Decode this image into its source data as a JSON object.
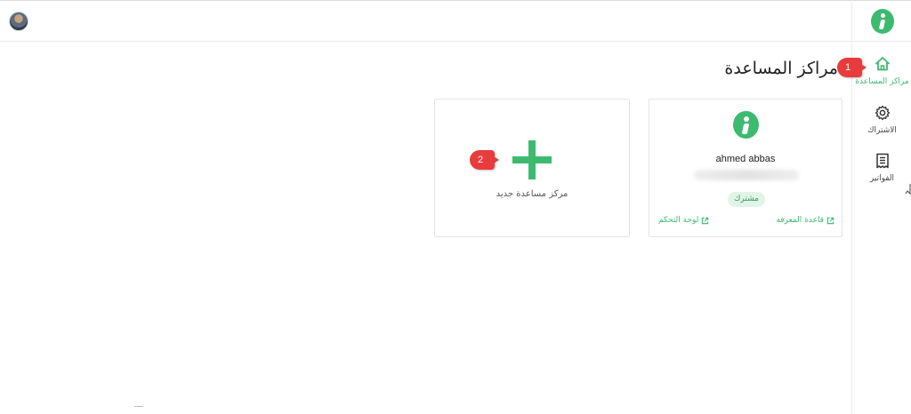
{
  "sidebar": {
    "logo_icon": "info-logo-icon",
    "items": [
      {
        "key": "home",
        "label": "مراكز المساعدة",
        "icon": "home-icon",
        "active": true
      },
      {
        "key": "subscription",
        "label": "الاشتراك",
        "icon": "gear-icon",
        "active": false
      },
      {
        "key": "invoices",
        "label": "الفواتير",
        "icon": "invoice-icon",
        "active": false
      }
    ]
  },
  "main": {
    "title": "مراكز المساعدة",
    "help_center_card": {
      "name": "ahmed abbas",
      "badge": "مشترك",
      "knowledge_base_link": "قاعدة المعرفة",
      "dashboard_link": "لوحة التحكم"
    },
    "new_help_center_card": {
      "label": "مركز مساعدة جديد"
    }
  },
  "annotations": {
    "step1": "1",
    "step2": "2"
  },
  "colors": {
    "accent": "#3dba6f",
    "badge_bg": "#e1f4e7",
    "step_marker": "#e83c3c"
  }
}
